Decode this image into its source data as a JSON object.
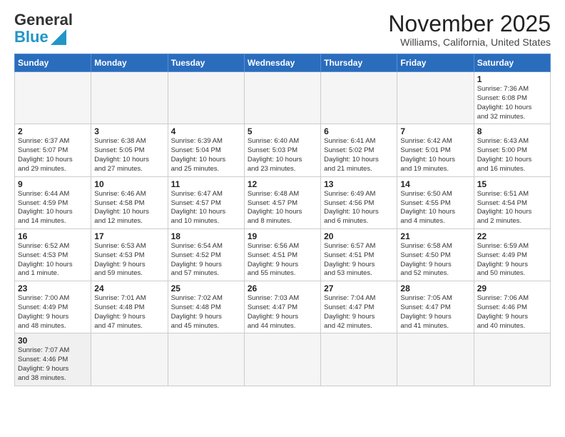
{
  "header": {
    "logo_general": "General",
    "logo_blue": "Blue",
    "month": "November 2025",
    "location": "Williams, California, United States"
  },
  "calendar": {
    "days_of_week": [
      "Sunday",
      "Monday",
      "Tuesday",
      "Wednesday",
      "Thursday",
      "Friday",
      "Saturday"
    ],
    "weeks": [
      [
        {
          "day": "",
          "info": ""
        },
        {
          "day": "",
          "info": ""
        },
        {
          "day": "",
          "info": ""
        },
        {
          "day": "",
          "info": ""
        },
        {
          "day": "",
          "info": ""
        },
        {
          "day": "",
          "info": ""
        },
        {
          "day": "1",
          "info": "Sunrise: 7:36 AM\nSunset: 6:08 PM\nDaylight: 10 hours\nand 32 minutes."
        }
      ],
      [
        {
          "day": "2",
          "info": "Sunrise: 6:37 AM\nSunset: 5:07 PM\nDaylight: 10 hours\nand 29 minutes."
        },
        {
          "day": "3",
          "info": "Sunrise: 6:38 AM\nSunset: 5:05 PM\nDaylight: 10 hours\nand 27 minutes."
        },
        {
          "day": "4",
          "info": "Sunrise: 6:39 AM\nSunset: 5:04 PM\nDaylight: 10 hours\nand 25 minutes."
        },
        {
          "day": "5",
          "info": "Sunrise: 6:40 AM\nSunset: 5:03 PM\nDaylight: 10 hours\nand 23 minutes."
        },
        {
          "day": "6",
          "info": "Sunrise: 6:41 AM\nSunset: 5:02 PM\nDaylight: 10 hours\nand 21 minutes."
        },
        {
          "day": "7",
          "info": "Sunrise: 6:42 AM\nSunset: 5:01 PM\nDaylight: 10 hours\nand 19 minutes."
        },
        {
          "day": "8",
          "info": "Sunrise: 6:43 AM\nSunset: 5:00 PM\nDaylight: 10 hours\nand 16 minutes."
        }
      ],
      [
        {
          "day": "9",
          "info": "Sunrise: 6:44 AM\nSunset: 4:59 PM\nDaylight: 10 hours\nand 14 minutes."
        },
        {
          "day": "10",
          "info": "Sunrise: 6:46 AM\nSunset: 4:58 PM\nDaylight: 10 hours\nand 12 minutes."
        },
        {
          "day": "11",
          "info": "Sunrise: 6:47 AM\nSunset: 4:57 PM\nDaylight: 10 hours\nand 10 minutes."
        },
        {
          "day": "12",
          "info": "Sunrise: 6:48 AM\nSunset: 4:57 PM\nDaylight: 10 hours\nand 8 minutes."
        },
        {
          "day": "13",
          "info": "Sunrise: 6:49 AM\nSunset: 4:56 PM\nDaylight: 10 hours\nand 6 minutes."
        },
        {
          "day": "14",
          "info": "Sunrise: 6:50 AM\nSunset: 4:55 PM\nDaylight: 10 hours\nand 4 minutes."
        },
        {
          "day": "15",
          "info": "Sunrise: 6:51 AM\nSunset: 4:54 PM\nDaylight: 10 hours\nand 2 minutes."
        }
      ],
      [
        {
          "day": "16",
          "info": "Sunrise: 6:52 AM\nSunset: 4:53 PM\nDaylight: 10 hours\nand 1 minute."
        },
        {
          "day": "17",
          "info": "Sunrise: 6:53 AM\nSunset: 4:53 PM\nDaylight: 9 hours\nand 59 minutes."
        },
        {
          "day": "18",
          "info": "Sunrise: 6:54 AM\nSunset: 4:52 PM\nDaylight: 9 hours\nand 57 minutes."
        },
        {
          "day": "19",
          "info": "Sunrise: 6:56 AM\nSunset: 4:51 PM\nDaylight: 9 hours\nand 55 minutes."
        },
        {
          "day": "20",
          "info": "Sunrise: 6:57 AM\nSunset: 4:51 PM\nDaylight: 9 hours\nand 53 minutes."
        },
        {
          "day": "21",
          "info": "Sunrise: 6:58 AM\nSunset: 4:50 PM\nDaylight: 9 hours\nand 52 minutes."
        },
        {
          "day": "22",
          "info": "Sunrise: 6:59 AM\nSunset: 4:49 PM\nDaylight: 9 hours\nand 50 minutes."
        }
      ],
      [
        {
          "day": "23",
          "info": "Sunrise: 7:00 AM\nSunset: 4:49 PM\nDaylight: 9 hours\nand 48 minutes."
        },
        {
          "day": "24",
          "info": "Sunrise: 7:01 AM\nSunset: 4:48 PM\nDaylight: 9 hours\nand 47 minutes."
        },
        {
          "day": "25",
          "info": "Sunrise: 7:02 AM\nSunset: 4:48 PM\nDaylight: 9 hours\nand 45 minutes."
        },
        {
          "day": "26",
          "info": "Sunrise: 7:03 AM\nSunset: 4:47 PM\nDaylight: 9 hours\nand 44 minutes."
        },
        {
          "day": "27",
          "info": "Sunrise: 7:04 AM\nSunset: 4:47 PM\nDaylight: 9 hours\nand 42 minutes."
        },
        {
          "day": "28",
          "info": "Sunrise: 7:05 AM\nSunset: 4:47 PM\nDaylight: 9 hours\nand 41 minutes."
        },
        {
          "day": "29",
          "info": "Sunrise: 7:06 AM\nSunset: 4:46 PM\nDaylight: 9 hours\nand 40 minutes."
        }
      ],
      [
        {
          "day": "30",
          "info": "Sunrise: 7:07 AM\nSunset: 4:46 PM\nDaylight: 9 hours\nand 38 minutes."
        },
        {
          "day": "",
          "info": ""
        },
        {
          "day": "",
          "info": ""
        },
        {
          "day": "",
          "info": ""
        },
        {
          "day": "",
          "info": ""
        },
        {
          "day": "",
          "info": ""
        },
        {
          "day": "",
          "info": ""
        }
      ]
    ]
  }
}
